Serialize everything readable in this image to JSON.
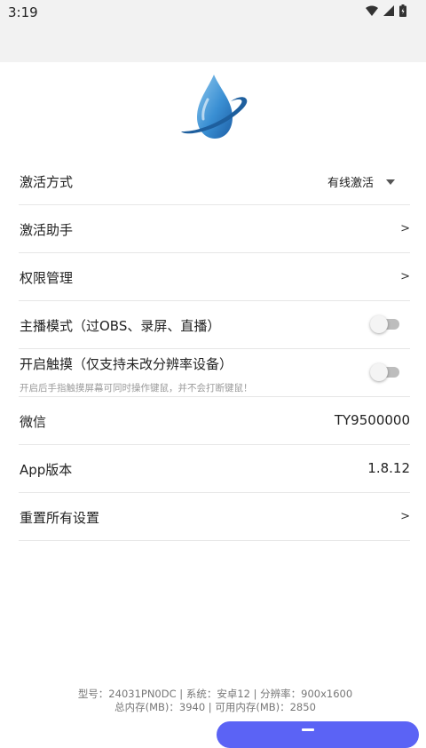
{
  "status_bar": {
    "time": "3:19"
  },
  "settings": {
    "activation_mode": {
      "label": "激活方式",
      "value": "有线激活"
    },
    "activation_helper": {
      "label": "激活助手",
      "arrow": ">"
    },
    "permissions": {
      "label": "权限管理",
      "arrow": ">"
    },
    "streamer_mode": {
      "label": "主播模式（过OBS、录屏、直播）",
      "enabled": false
    },
    "touch": {
      "label": "开启触摸（仅支持未改分辨率设备）",
      "description": "开启后手指触摸屏幕可同时操作键鼠，并不会打断键鼠！",
      "enabled": false
    },
    "wechat": {
      "label": "微信",
      "value": "TY9500000"
    },
    "app_version": {
      "label": "App版本",
      "value": "1.8.12"
    },
    "reset": {
      "label": "重置所有设置",
      "arrow": ">"
    }
  },
  "footer": {
    "line1": "型号：24031PN0DC | 系统：安卓12 | 分辨率：900x1600",
    "line2": "总内存(MB)：3940 | 可用内存(MB)：2850"
  },
  "colors": {
    "accent": "#5b63f5",
    "logo_blue": "#2f7fc8"
  }
}
